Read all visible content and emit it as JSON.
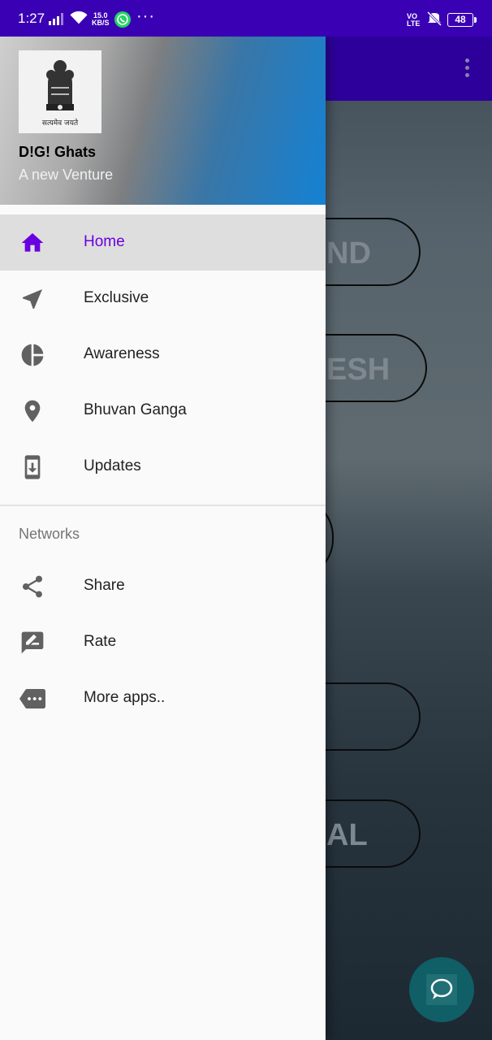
{
  "status_bar": {
    "time": "1:27",
    "net_speed_value": "15.0",
    "net_speed_unit": "KB/S",
    "more": "···",
    "volte_top": "VO",
    "volte_bottom": "LTE",
    "battery": "48"
  },
  "drawer": {
    "app_name": "D!G! Ghats",
    "app_subtitle": "A new Venture",
    "emblem_caption": "सत्यमेव जयते",
    "items": [
      {
        "label": "Home",
        "icon": "home-icon",
        "active": true
      },
      {
        "label": "Exclusive",
        "icon": "navigation-arrow-icon"
      },
      {
        "label": "Awareness",
        "icon": "pie-chart-icon"
      },
      {
        "label": "Bhuvan Ganga",
        "icon": "location-pin-icon"
      },
      {
        "label": "Updates",
        "icon": "phone-download-icon"
      }
    ],
    "section_title": "Networks",
    "network_items": [
      {
        "label": "Share",
        "icon": "share-icon"
      },
      {
        "label": "Rate",
        "icon": "rate-review-icon"
      },
      {
        "label": "More apps..",
        "icon": "more-apps-icon"
      }
    ]
  },
  "background": {
    "visible_fragments": [
      "ND",
      "ESH",
      "AL"
    ]
  },
  "colors": {
    "status_bar": "#3a00b4",
    "app_bar": "#2d009b",
    "active_item_text": "#6a00e0",
    "fab": "#105e66"
  }
}
